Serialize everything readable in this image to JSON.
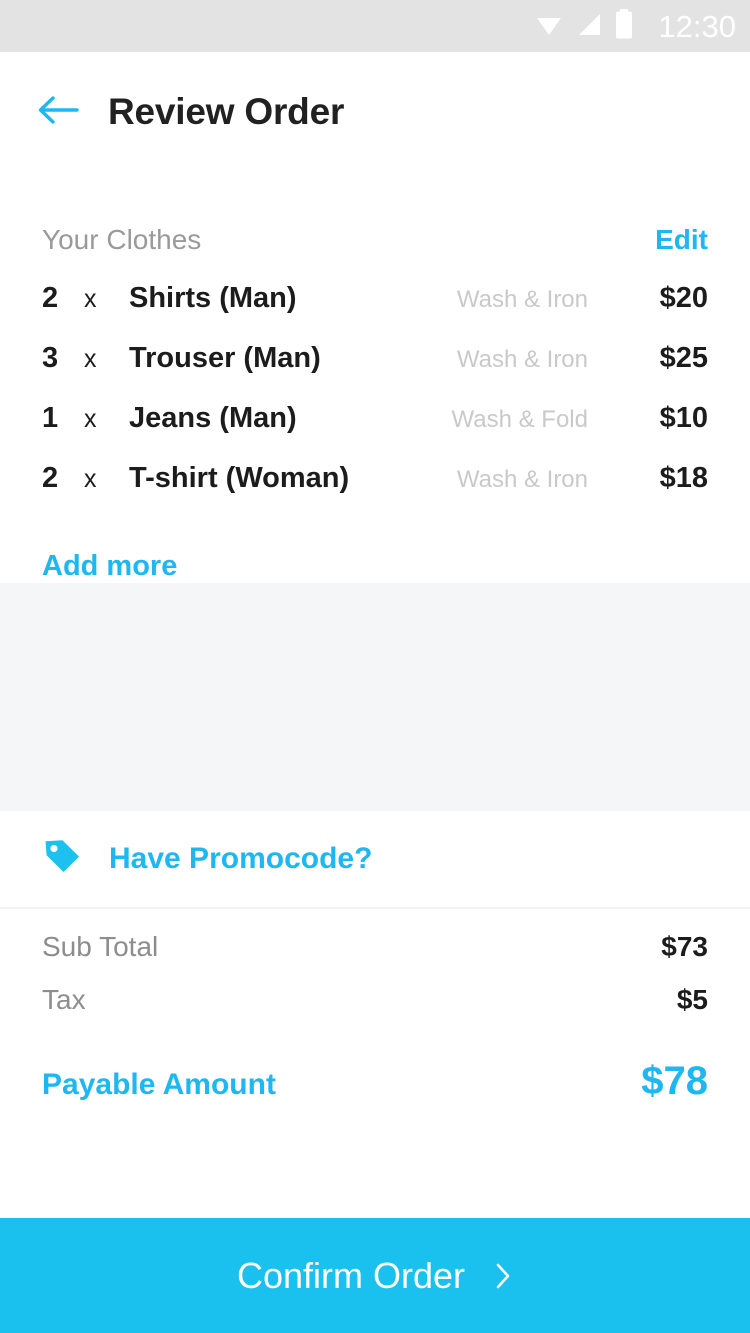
{
  "statusbar": {
    "time": "12:30",
    "icons": [
      "wifi-icon",
      "signal-icon",
      "battery-icon"
    ]
  },
  "header": {
    "back_icon": "arrow-left-icon",
    "title": "Review Order"
  },
  "clothes": {
    "section_title": "Your Clothes",
    "edit_label": "Edit",
    "multiplier": "x",
    "items": [
      {
        "qty": "2",
        "name": "Shirts (Man)",
        "service": "Wash & Iron",
        "price": "$20"
      },
      {
        "qty": "3",
        "name": "Trouser (Man)",
        "service": "Wash & Iron",
        "price": "$25"
      },
      {
        "qty": "1",
        "name": "Jeans (Man)",
        "service": "Wash & Fold",
        "price": "$10"
      },
      {
        "qty": "2",
        "name": "T-shirt (Woman)",
        "service": "Wash & Iron",
        "price": "$18"
      }
    ],
    "add_more_label": "Add more"
  },
  "promocode": {
    "icon": "tag-icon",
    "label": "Have Promocode?"
  },
  "totals": {
    "rows": [
      {
        "label": "Sub Total",
        "value": "$73"
      },
      {
        "label": "Tax",
        "value": "$5"
      }
    ],
    "payable_label": "Payable Amount",
    "payable_value": "$78"
  },
  "confirm": {
    "label": "Confirm Order",
    "chevron_icon": "chevron-right-icon"
  },
  "colors": {
    "accent": "#1eb7f0",
    "button": "#1ac1ef",
    "statusbar": "#e3e3e3",
    "spacer": "#f4f6f8",
    "text_dark": "#1c1c1c",
    "text_muted": "#9a9a9a",
    "text_light": "#c9c9c9"
  }
}
